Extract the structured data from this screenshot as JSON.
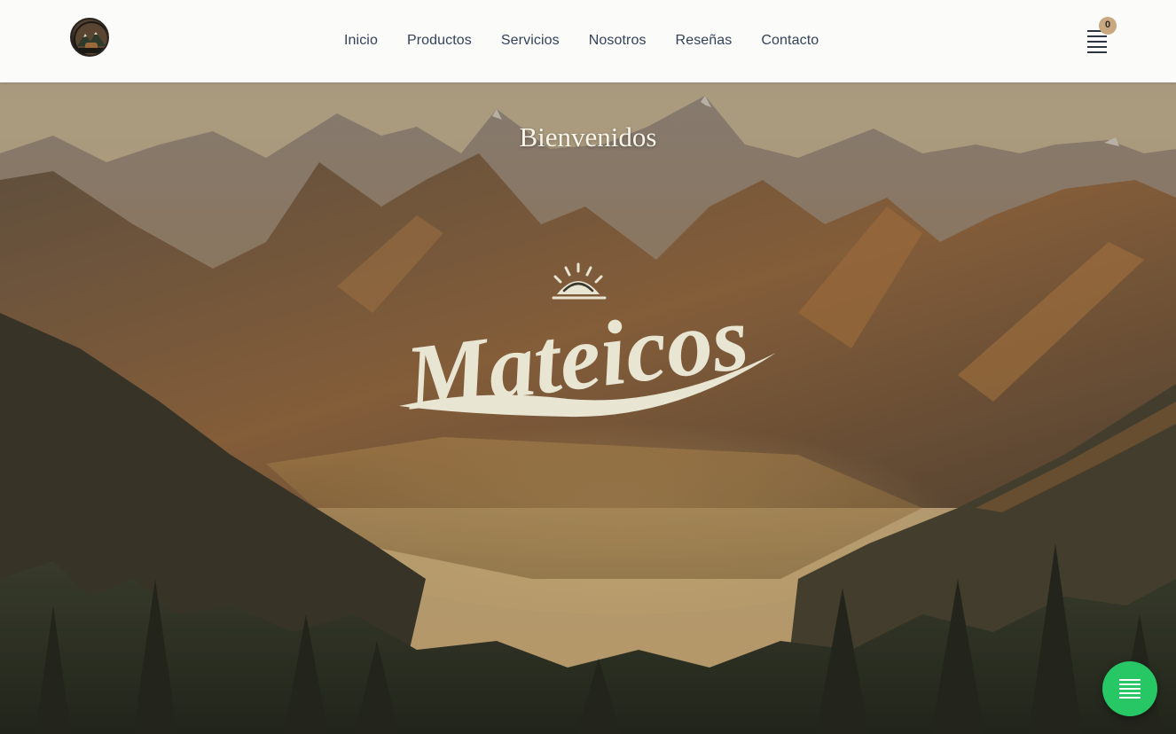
{
  "header": {
    "logo": {
      "icon": "mateicos-logo-icon"
    },
    "nav": [
      {
        "label": "Inicio"
      },
      {
        "label": "Productos"
      },
      {
        "label": "Servicios"
      },
      {
        "label": "Nosotros"
      },
      {
        "label": "Reseñas"
      },
      {
        "label": "Contacto"
      }
    ],
    "cart": {
      "icon": "menu-lines-icon",
      "count": "0"
    }
  },
  "hero": {
    "welcome": "Bienvenidos",
    "brand": "Mateicos"
  },
  "chat": {
    "icon": "menu-lines-icon"
  },
  "colors": {
    "header_bg": "#fbfbfa",
    "nav_text": "#33425a",
    "badge": "#c9a77f",
    "chat": "#27c766",
    "brand_text": "#e8e5d3"
  }
}
